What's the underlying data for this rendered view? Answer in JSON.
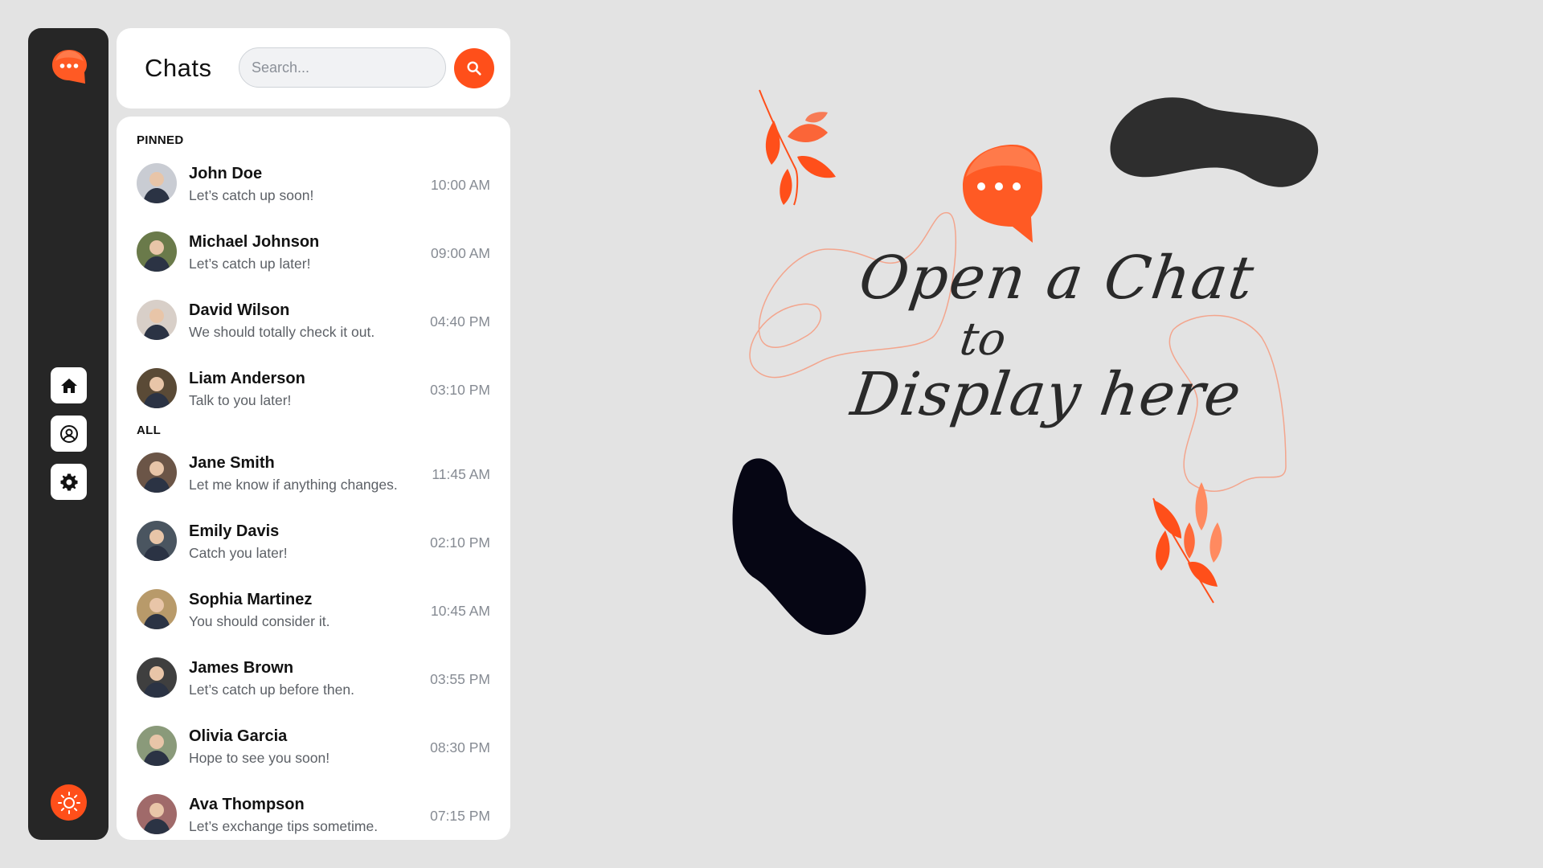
{
  "app": {
    "accent_color": "#ff4f1a",
    "rail_color": "#262626"
  },
  "rail": {
    "logo_icon": "chat-bubble-icon",
    "nav": [
      {
        "id": "home",
        "icon": "home-icon"
      },
      {
        "id": "profile",
        "icon": "user-circle-icon"
      },
      {
        "id": "settings",
        "icon": "gear-icon"
      }
    ],
    "theme_icon": "sun-icon"
  },
  "header": {
    "title": "Chats",
    "search_placeholder": "Search...",
    "search_icon": "search-icon"
  },
  "chat_list": {
    "pinned_label": "PINNED",
    "all_label": "ALL",
    "pinned": [
      {
        "name": "John Doe",
        "preview": "Let’s catch up soon!",
        "time": "10:00 AM",
        "avatar_color": "#c9ccd3"
      },
      {
        "name": "Michael Johnson",
        "preview": "Let’s catch up later!",
        "time": "09:00 AM",
        "avatar_color": "#6a7a4a"
      },
      {
        "name": "David Wilson",
        "preview": "We should totally check it out.",
        "time": "04:40 PM",
        "avatar_color": "#d8cfc8"
      },
      {
        "name": "Liam Anderson",
        "preview": "Talk to you later!",
        "time": "03:10 PM",
        "avatar_color": "#5a4a36"
      }
    ],
    "all": [
      {
        "name": "Jane Smith",
        "preview": "Let me know if anything changes.",
        "time": "11:45 AM",
        "avatar_color": "#6b5547"
      },
      {
        "name": "Emily Davis",
        "preview": "Catch you later!",
        "time": "02:10 PM",
        "avatar_color": "#4a5560"
      },
      {
        "name": "Sophia Martinez",
        "preview": "You should consider it.",
        "time": "10:45 AM",
        "avatar_color": "#b89a6a"
      },
      {
        "name": "James Brown",
        "preview": "Let’s catch up before then.",
        "time": "03:55 PM",
        "avatar_color": "#3f3f3f"
      },
      {
        "name": "Olivia Garcia",
        "preview": "Hope to see you soon!",
        "time": "08:30 PM",
        "avatar_color": "#8a9a7a"
      },
      {
        "name": "Ava Thompson",
        "preview": "Let’s exchange tips sometime.",
        "time": "07:15 PM",
        "avatar_color": "#a06a6a"
      }
    ]
  },
  "empty_state": {
    "line1": "Open a Chat",
    "line2": "to",
    "line3": "Display here"
  }
}
